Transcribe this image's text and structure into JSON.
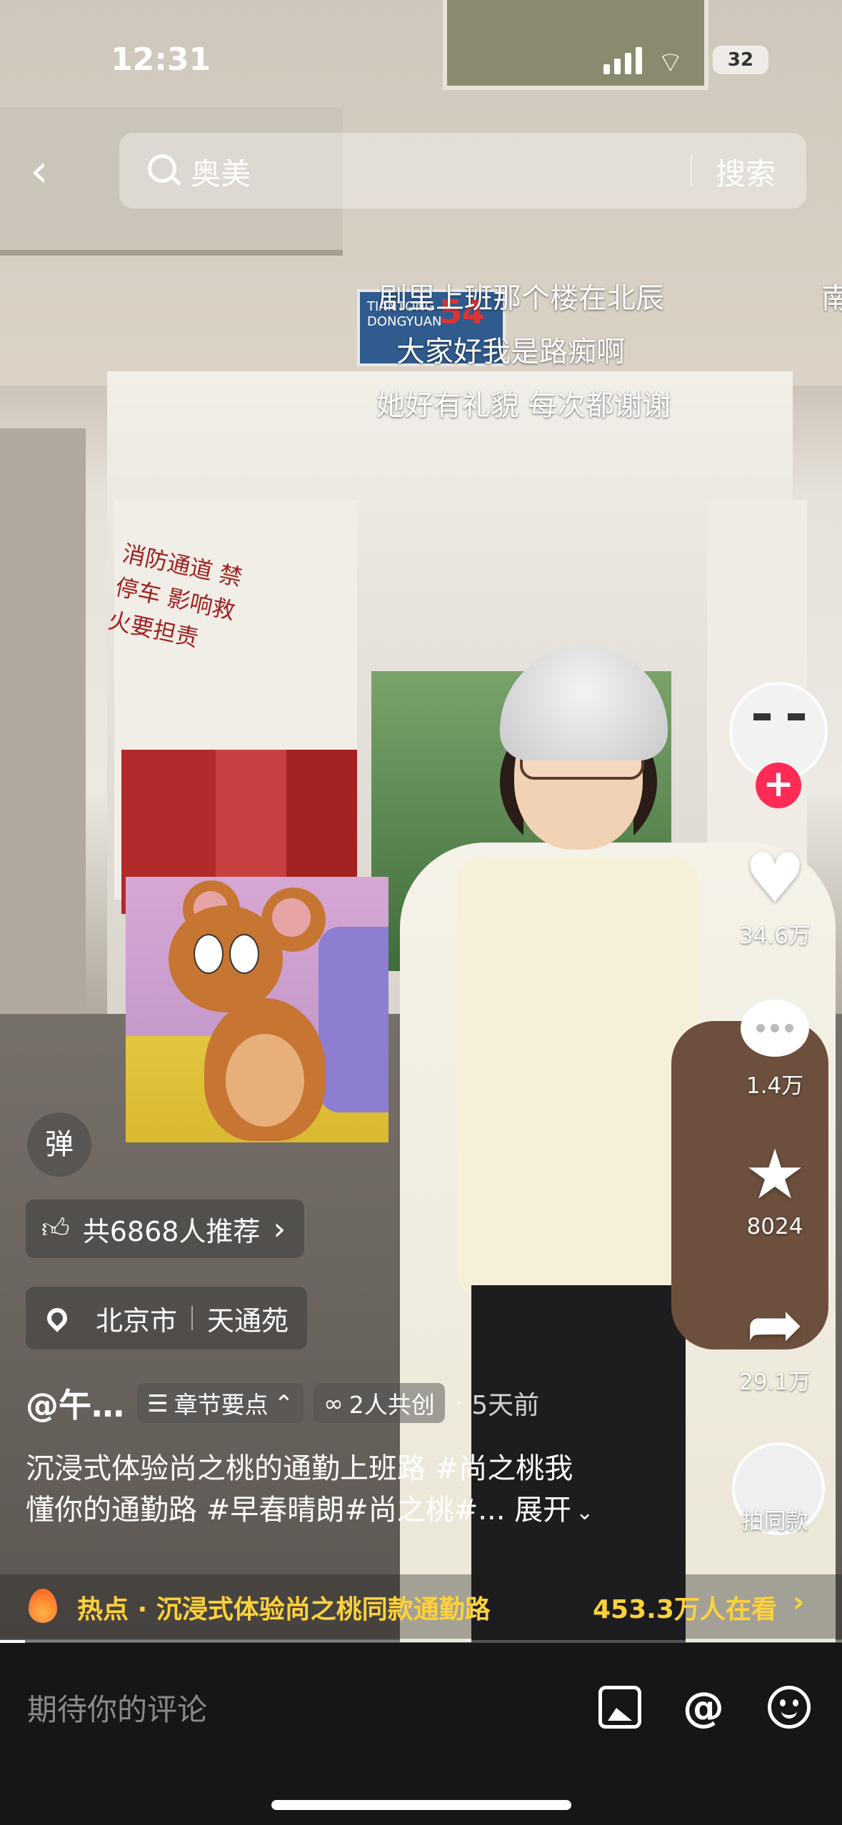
{
  "status_bar": {
    "time": "12:31",
    "battery": "32"
  },
  "search": {
    "query": "奥美",
    "action": "搜索"
  },
  "danmaku": [
    "剧里上班那个楼在北辰",
    "南",
    "大家好我是路痴啊",
    "她好有礼貌 每次都谢谢"
  ],
  "scene_text": {
    "street_sign": "TIANTONG DONGYUAN",
    "street_number": "54",
    "wall_slogan": "消防通道 禁停车 影响救火要担责"
  },
  "actions": {
    "likes": "34.6万",
    "comments": "1.4万",
    "favorites": "8024",
    "shares": "29.1万",
    "same_style": "拍同款",
    "follow": "+"
  },
  "danmaku_toggle": "弹",
  "recommend": {
    "label": "共6868人推荐",
    "chevron": "›"
  },
  "location": {
    "city": "北京市",
    "place": "天通苑"
  },
  "author": {
    "name": "@午…",
    "chapter_tag": "章节要点",
    "collab_tag": "2人共创",
    "dot": "·",
    "time_ago": "5天前"
  },
  "description": {
    "line1": "沉浸式体验尚之桃的通勤上班路 #尚之桃我",
    "line2": "懂你的通勤路 #早春晴朗#尚之桃#... 展开"
  },
  "hot": {
    "label": "热点 · 沉浸式体验尚之桃同款通勤路",
    "watching": "453.3万人在看",
    "chevron": "›"
  },
  "progress": {
    "fraction": 0.03
  },
  "comment_bar": {
    "placeholder": "期待你的评论",
    "at": "@"
  },
  "colors": {
    "accent_red": "#fe2c55",
    "hot_yellow": "#ffd23b"
  }
}
